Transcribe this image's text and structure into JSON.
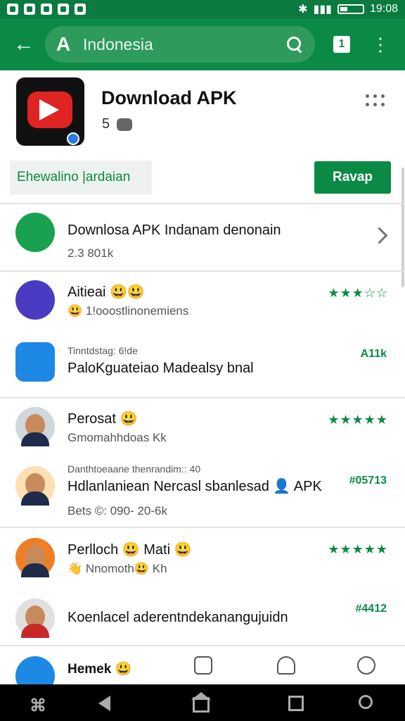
{
  "status_bar": {
    "time": "19:08",
    "left_icons": [
      "screenshot-icon",
      "n-icon",
      "game-icon",
      "app-icon",
      "sync-icon"
    ],
    "right_icons": [
      "bluetooth-icon",
      "signal-icon",
      "battery-icon"
    ]
  },
  "app_bar": {
    "search_text": "Indonesia",
    "tab_count": "1",
    "colors": {
      "bar": "#0b8a45",
      "accent": "#0b8a45"
    }
  },
  "header": {
    "title": "Download APK",
    "rating": "5"
  },
  "actions": {
    "chip_label": "Ehewalino |ardaian",
    "install_label": "Ravap"
  },
  "rows": [
    {
      "title": "Downlosa APK Indanam denonain",
      "subtitle": "2.3 801k",
      "meta": "",
      "avatar_color": "#1aa14f"
    },
    {
      "title": "Aitieai 😃😃",
      "subtitle": "😃 1!ooostlinonemiens",
      "meta": "★★★☆☆",
      "avatar_color": "#4a3cc2"
    },
    {
      "small": "Tinntdstag: 6!de",
      "title": "PaloKguateiao Madealsy bnal",
      "meta": "A11k",
      "avatar_color": "#1e88e5"
    },
    {
      "title": "Perosat 😃",
      "subtitle": "Gmomahhdoas  Kk",
      "meta": "★★★★★",
      "avatar_color": "#cfd8dc"
    },
    {
      "small": "Danthtoeaane thenrandim:: 40",
      "title": "Hdlanlaniean Nercasl sbanlesad 👤 APK",
      "subtitle": "Bets ©: 090- 20-6k",
      "meta": "#05713",
      "avatar_color": "#ffe0b2"
    },
    {
      "title": "Perlloch 😃 Mati 😃",
      "subtitle": "👋 Nnomoth😃  Kh",
      "meta": "★★★★★",
      "avatar_color": "#ef7f27"
    },
    {
      "title": "Koenlacel aderentndekanangujuidn",
      "subtitle": "",
      "meta": "#4412",
      "avatar_color": "#e0e0e0"
    }
  ],
  "bottom_tabs": {
    "first_label": "Hemek 😃",
    "icons": [
      "home-icon",
      "add-icon",
      "notification-icon",
      "info-icon"
    ]
  },
  "nav_bar": {
    "buttons": [
      "menu-icon",
      "back-icon",
      "home-icon",
      "recent-apps-icon",
      "assistant-icon"
    ]
  }
}
